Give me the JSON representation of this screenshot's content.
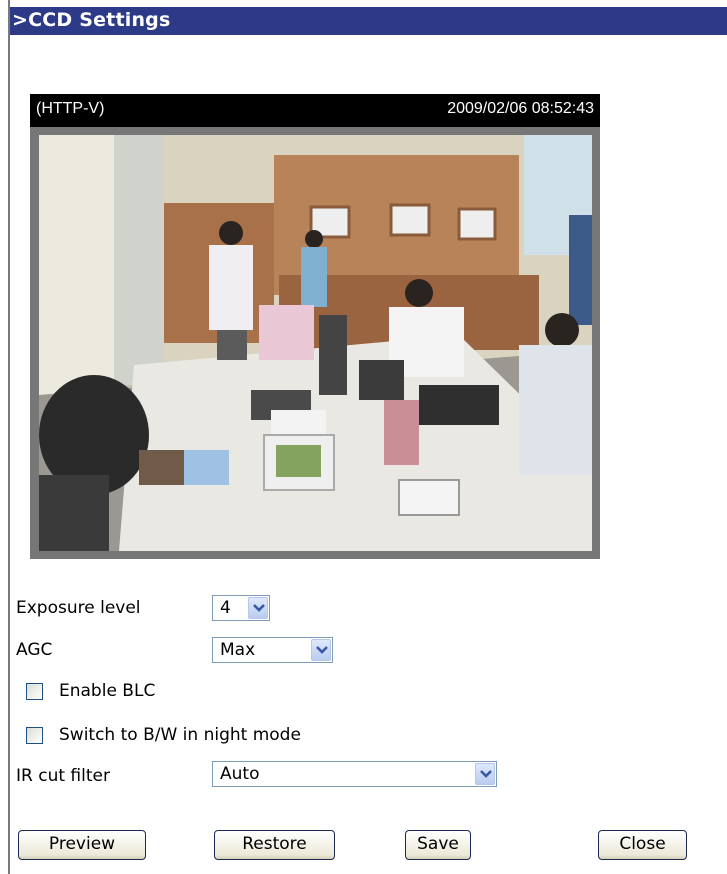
{
  "header": {
    "title": ">CCD Settings"
  },
  "video": {
    "source_label": "(HTTP-V)",
    "timestamp": "2009/02/06 08:52:43"
  },
  "settings": {
    "exposure_level": {
      "label": "Exposure level",
      "value": "4"
    },
    "agc": {
      "label": "AGC",
      "value": "Max"
    },
    "enable_blc": {
      "label": "Enable BLC",
      "checked": false
    },
    "bw_night_mode": {
      "label": "Switch to B/W in night mode",
      "checked": false
    },
    "ir_cut_filter": {
      "label": "IR cut filter",
      "value": "Auto"
    }
  },
  "buttons": {
    "preview": "Preview",
    "restore": "Restore",
    "save": "Save",
    "close": "Close"
  },
  "colors": {
    "title_bar": "#2c3a87",
    "frame": "#777777"
  }
}
